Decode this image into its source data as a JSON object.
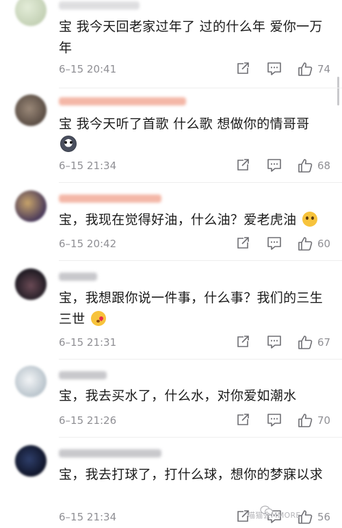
{
  "comments": [
    {
      "text": "宝 我今天回老家过年了 过的什么年 爱你一万年",
      "emoji": "",
      "time": "6–15 20:41",
      "likes": "74"
    },
    {
      "text": "宝 我今天听了首歌 什么歌 想做你的情哥哥",
      "emoji": "husky-emoji",
      "time": "6–15 21:34",
      "likes": "68"
    },
    {
      "text": "宝，我现在觉得好油，什么油？爱老虎油",
      "emoji": "drooling-emoji",
      "time": "6–15 20:42",
      "likes": "60"
    },
    {
      "text": "宝，我想跟你说一件事，什么事？我们的三生三世",
      "emoji": "kiss-emoji",
      "time": "6–15 21:31",
      "likes": "67"
    },
    {
      "text": "宝，我去买水了，什么水，对你爱如潮水",
      "emoji": "",
      "time": "6–15 21:26",
      "likes": "70"
    },
    {
      "text": "宝，我去打球了，打什么球，想你的梦寐以求",
      "emoji": "",
      "time": "6–15 21:34",
      "likes": "56"
    }
  ],
  "icons": {
    "share": "share-icon",
    "reply": "comment-icon",
    "like": "thumbs-up-icon"
  },
  "colors": {
    "text": "#1a1a1a",
    "meta": "#8f8f94",
    "username_vip": "#f4b7a7",
    "username_regular": "#c8c8cc"
  },
  "watermark": {
    "right": "喵猫会MMORE"
  }
}
